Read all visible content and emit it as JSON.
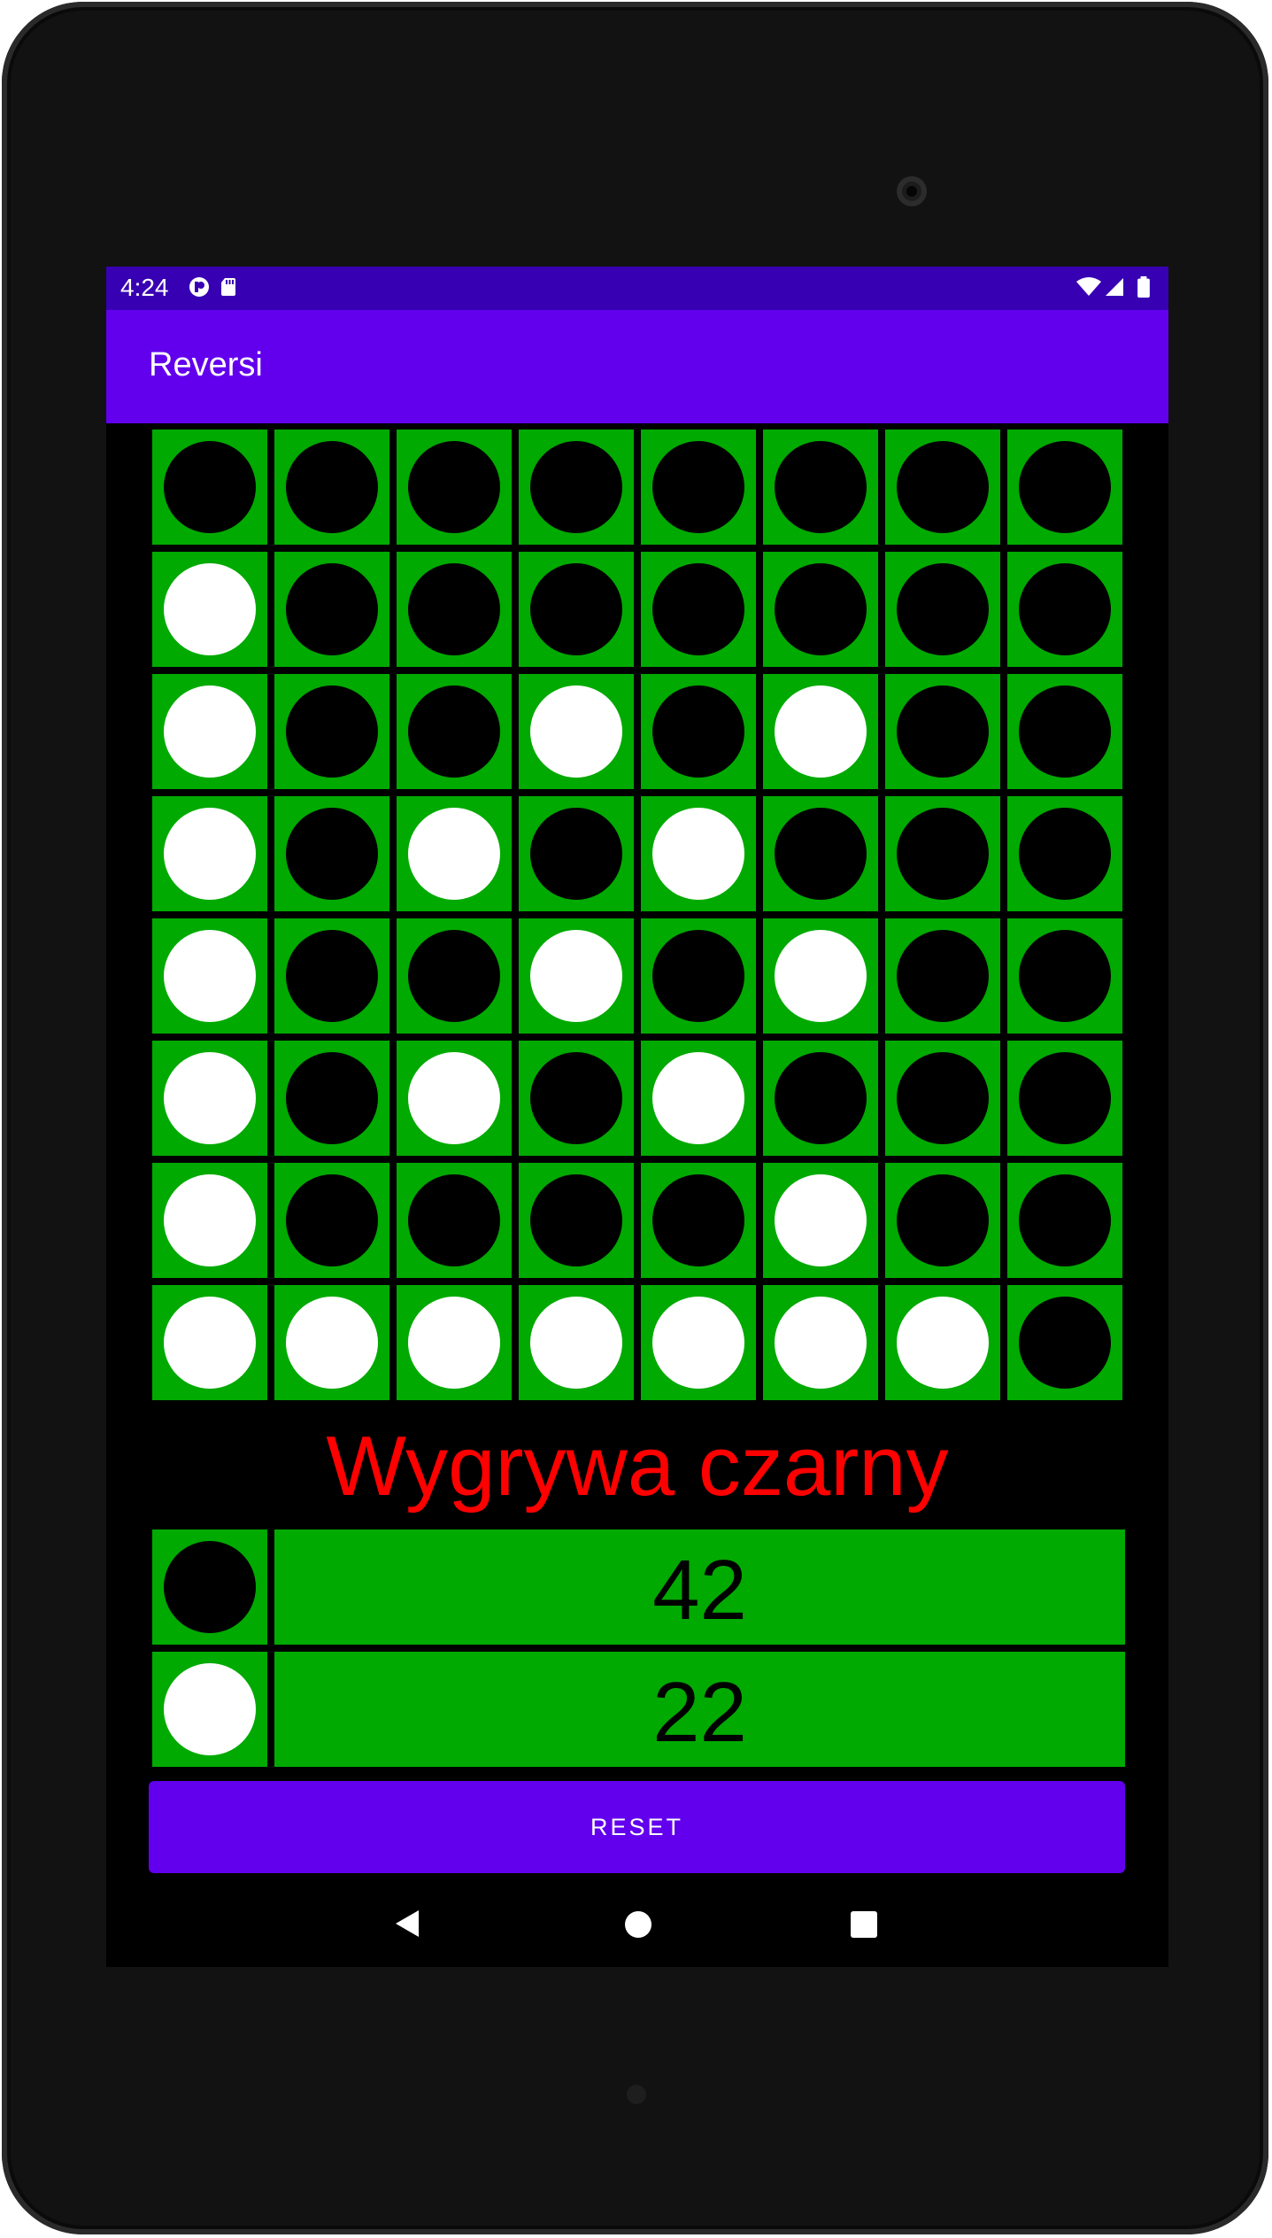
{
  "status_bar": {
    "time": "4:24"
  },
  "app_bar": {
    "title": "Reversi"
  },
  "board": {
    "rows": [
      [
        "b",
        "b",
        "b",
        "b",
        "b",
        "b",
        "b",
        "b"
      ],
      [
        "w",
        "b",
        "b",
        "b",
        "b",
        "b",
        "b",
        "b"
      ],
      [
        "w",
        "b",
        "b",
        "w",
        "b",
        "w",
        "b",
        "b"
      ],
      [
        "w",
        "b",
        "w",
        "b",
        "w",
        "b",
        "b",
        "b"
      ],
      [
        "w",
        "b",
        "b",
        "w",
        "b",
        "w",
        "b",
        "b"
      ],
      [
        "w",
        "b",
        "w",
        "b",
        "w",
        "b",
        "b",
        "b"
      ],
      [
        "w",
        "b",
        "b",
        "b",
        "b",
        "w",
        "b",
        "b"
      ],
      [
        "w",
        "w",
        "w",
        "w",
        "w",
        "w",
        "w",
        "b"
      ]
    ]
  },
  "winner_text": "Wygrywa czarny",
  "scores": {
    "black": "42",
    "white": "22"
  },
  "reset_label": "RESET",
  "colors": {
    "board_green": "#00aa00",
    "accent": "#6200ee",
    "status": "#3700b3",
    "winner": "#ff0000"
  }
}
